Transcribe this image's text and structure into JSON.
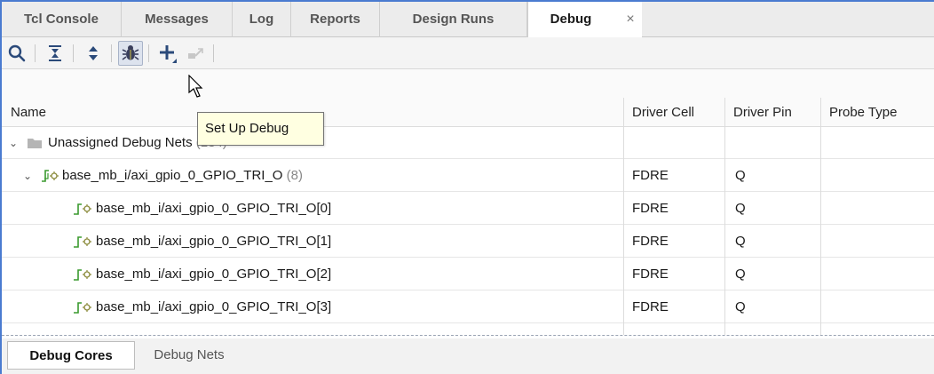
{
  "tabs": [
    {
      "label": "Tcl Console"
    },
    {
      "label": "Messages"
    },
    {
      "label": "Log"
    },
    {
      "label": "Reports"
    },
    {
      "label": "Design Runs"
    },
    {
      "label": "Debug"
    }
  ],
  "active_tab": "Debug",
  "close_glyph": "×",
  "toolbar": {
    "buttons": [
      "search-icon",
      "collapse-all-icon",
      "expand-all-icon",
      "bug-icon",
      "plus-icon",
      "disconnect-icon"
    ],
    "tooltip": "Set Up Debug"
  },
  "table": {
    "columns": [
      "Name",
      "Driver Cell",
      "Driver Pin",
      "Probe Type"
    ],
    "group": {
      "label": "Unassigned Debug Nets",
      "count": "(134)"
    },
    "bus": {
      "name": "base_mb_i/axi_gpio_0_GPIO_TRI_O",
      "count": "(8)",
      "driver_cell": "FDRE",
      "driver_pin": "Q"
    },
    "nets": [
      {
        "name": "base_mb_i/axi_gpio_0_GPIO_TRI_O[0]",
        "driver_cell": "FDRE",
        "driver_pin": "Q"
      },
      {
        "name": "base_mb_i/axi_gpio_0_GPIO_TRI_O[1]",
        "driver_cell": "FDRE",
        "driver_pin": "Q"
      },
      {
        "name": "base_mb_i/axi_gpio_0_GPIO_TRI_O[2]",
        "driver_cell": "FDRE",
        "driver_pin": "Q"
      },
      {
        "name": "base_mb_i/axi_gpio_0_GPIO_TRI_O[3]",
        "driver_cell": "FDRE",
        "driver_pin": "Q"
      }
    ]
  },
  "bottom_tabs": [
    {
      "label": "Debug Cores"
    },
    {
      "label": "Debug Nets"
    }
  ],
  "colors": {
    "frame_border": "#4a7bd0",
    "net_icon_green": "#3a9a2e",
    "tooltip_bg": "#ffffe1"
  }
}
